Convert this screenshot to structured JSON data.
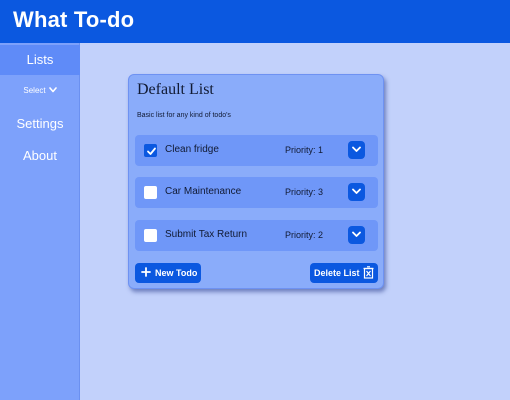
{
  "app": {
    "title": "What To-do"
  },
  "sidebar": {
    "lists_label": "Lists",
    "select_label": "Select",
    "settings_label": "Settings",
    "about_label": "About"
  },
  "list": {
    "title": "Default List",
    "description": "Basic list for any kind of todo's",
    "todos": [
      {
        "name": "Clean fridge",
        "priority_label": "Priority: 1",
        "checked": true
      },
      {
        "name": "Car Maintenance",
        "priority_label": "Priority: 3",
        "checked": false
      },
      {
        "name": "Submit Tax Return",
        "priority_label": "Priority: 2",
        "checked": false
      }
    ],
    "new_todo_label": "New Todo",
    "delete_list_label": "Delete List"
  },
  "colors": {
    "primary": "#0b58e0",
    "background": "#c2d1fb",
    "sidebar": "#7da1fb",
    "card": "#8aacfa",
    "todo_row": "#6f97f8"
  },
  "icons": [
    "chevron-down-icon",
    "checkbox-icon",
    "plus-icon",
    "trash-icon"
  ]
}
